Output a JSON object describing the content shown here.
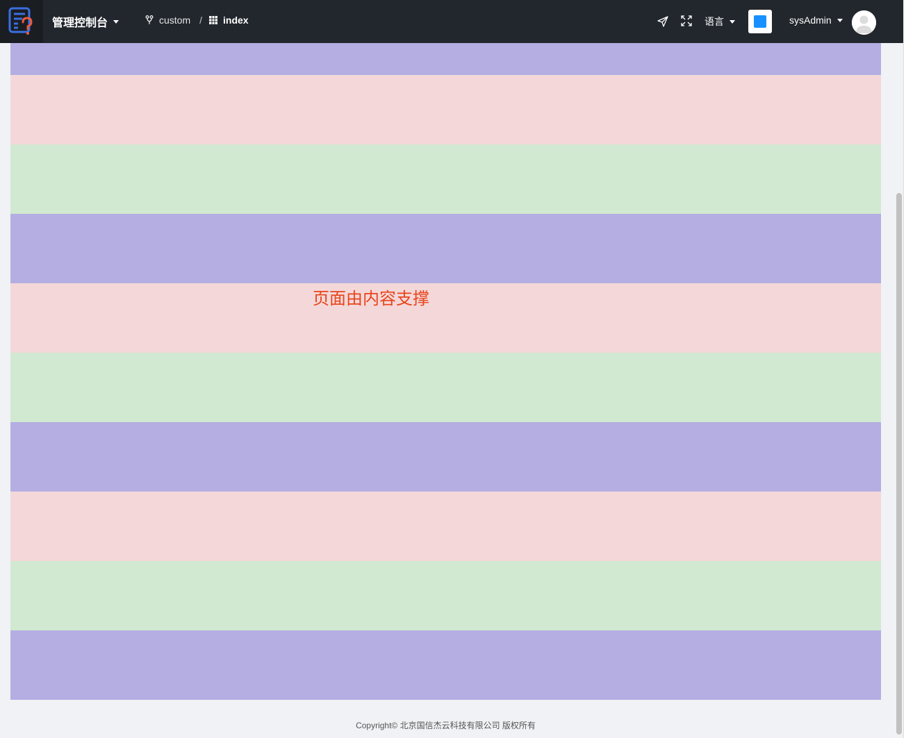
{
  "header": {
    "app_title": "管理控制台",
    "breadcrumb": [
      {
        "label": "custom",
        "icon": "branch-icon"
      },
      {
        "label": "index",
        "icon": "grid-icon"
      }
    ],
    "breadcrumb_separator": "/",
    "language_label": "语言",
    "username": "sysAdmin",
    "theme_color": "#1890ff"
  },
  "content": {
    "support_text": "页面由内容支撑",
    "stripe_colors": {
      "purple": "#b4aee2",
      "pink": "#f4d8d9",
      "green": "#d1e9d0"
    },
    "text_color": "#e8441a"
  },
  "footer": {
    "copyright": "Copyright© 北京国信杰云科技有限公司 版权所有"
  }
}
